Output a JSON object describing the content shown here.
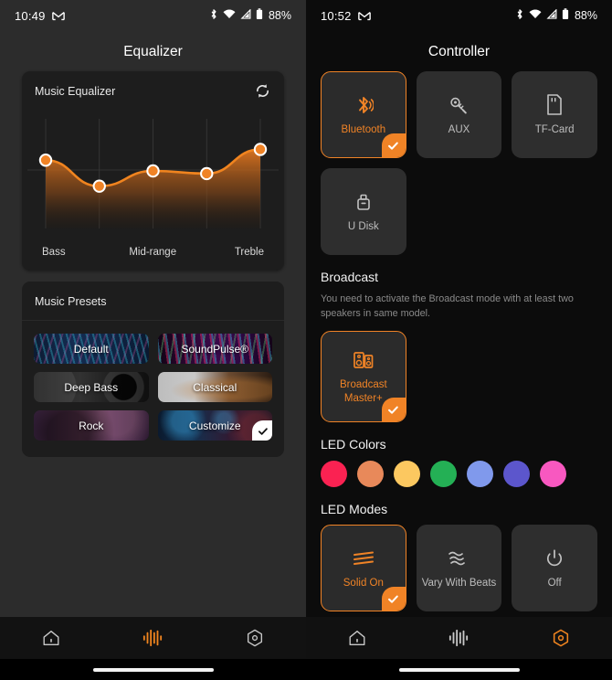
{
  "left": {
    "status": {
      "time": "10:49",
      "gmail_icon": "gmail-icon",
      "bluetooth_icon": "bluetooth-icon",
      "wifi_icon": "wifi-icon",
      "signal_icon": "cellular-signal-icon",
      "battery_icon": "battery-icon",
      "battery_text": "88%"
    },
    "title": "Equalizer",
    "equalizer_card": {
      "title": "Music Equalizer",
      "refresh_icon": "refresh-icon"
    },
    "presets_card": {
      "title": "Music Presets",
      "items": [
        {
          "label": "Default",
          "selected": false,
          "art": "blue-waveform"
        },
        {
          "label": "SoundPulse®",
          "selected": false,
          "art": "neon-rainbow-waves"
        },
        {
          "label": "Deep Bass",
          "selected": false,
          "art": "dark-speaker"
        },
        {
          "label": "Classical",
          "selected": false,
          "art": "light-violin"
        },
        {
          "label": "Rock",
          "selected": false,
          "art": "purple-concert"
        },
        {
          "label": "Customize",
          "selected": true,
          "art": "dark-blue-stage"
        }
      ]
    },
    "nav": [
      {
        "name": "home",
        "icon": "home-icon",
        "active": false
      },
      {
        "name": "equalizer",
        "icon": "equalizer-icon",
        "active": true
      },
      {
        "name": "settings",
        "icon": "hexagon-gear-icon",
        "active": false
      }
    ]
  },
  "right": {
    "status": {
      "time": "10:52",
      "gmail_icon": "gmail-icon",
      "bluetooth_icon": "bluetooth-icon",
      "wifi_icon": "wifi-icon",
      "signal_icon": "cellular-signal-icon",
      "battery_icon": "battery-icon",
      "battery_text": "88%"
    },
    "title": "Controller",
    "sources": [
      {
        "label": "Bluetooth",
        "icon": "bluetooth-icon",
        "selected": true
      },
      {
        "label": "AUX",
        "icon": "aux-plug-icon",
        "selected": false
      },
      {
        "label": "TF-Card",
        "icon": "sd-card-icon",
        "selected": false
      },
      {
        "label": "U Disk",
        "icon": "usb-drive-icon",
        "selected": false
      }
    ],
    "broadcast": {
      "title": "Broadcast",
      "description": "You need to activate the Broadcast mode with at least two speakers in same model.",
      "items": [
        {
          "label": "Broadcast Master+",
          "icon": "broadcast-speakers-icon",
          "selected": true
        }
      ]
    },
    "led_colors": {
      "title": "LED Colors",
      "swatches": [
        "#fa2252",
        "#e8895a",
        "#fcc860",
        "#24b055",
        "#8099ec",
        "#5c56cc",
        "#f858c0"
      ]
    },
    "led_modes": {
      "title": "LED Modes",
      "items": [
        {
          "label": "Solid On",
          "icon": "solid-lines-icon",
          "selected": true
        },
        {
          "label": "Vary With Beats",
          "icon": "wavy-lines-icon",
          "selected": false
        },
        {
          "label": "Off",
          "icon": "power-icon",
          "selected": false
        }
      ]
    },
    "nav": [
      {
        "name": "home",
        "icon": "home-icon",
        "active": false
      },
      {
        "name": "equalizer",
        "icon": "equalizer-icon",
        "active": false
      },
      {
        "name": "settings",
        "icon": "hexagon-gear-icon",
        "active": true
      }
    ]
  },
  "chart_data": {
    "type": "line",
    "title": "Music Equalizer",
    "xlabel": "",
    "ylabel": "",
    "categories": [
      "Bass",
      "",
      "Mid-range",
      "",
      "Treble"
    ],
    "tick_labels": [
      "Bass",
      "Mid-range",
      "Treble"
    ],
    "x": [
      0,
      1,
      2,
      3,
      4
    ],
    "values": [
      6.2,
      3.3,
      5.0,
      4.7,
      7.4
    ],
    "ylim": [
      0,
      10
    ],
    "grid": true,
    "fill": true,
    "line_color": "#f08326",
    "point_fill": "#f08326",
    "point_stroke": "#ffffff",
    "legend": "none"
  }
}
